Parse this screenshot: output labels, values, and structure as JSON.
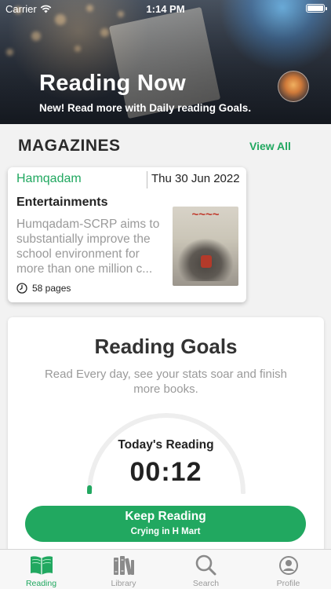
{
  "status_bar": {
    "carrier": "Carrier",
    "time": "1:14 PM"
  },
  "hero": {
    "title": "Reading Now",
    "subtitle": "New! Read more with Daily reading Goals."
  },
  "magazines": {
    "section_title": "MAGAZINES",
    "view_all": "View All",
    "card": {
      "publisher": "Hamqadam",
      "date": "Thu 30 Jun 2022",
      "category": "Entertainments",
      "description": "Humqadam-SCRP aims to substantially improve the school environment for more than one million c...",
      "pages": "58 pages"
    }
  },
  "reading_goals": {
    "title": "Reading Goals",
    "description": "Read Every day, see your stats soar and finish more books.",
    "today_label": "Today's Reading",
    "today_time": "00:12",
    "progress_fraction": 0.02,
    "button_label": "Keep Reading",
    "button_sublabel": "Crying in H Mart"
  },
  "tabs": [
    {
      "label": "Reading",
      "icon": "book-open-icon",
      "active": true
    },
    {
      "label": "Library",
      "icon": "library-icon",
      "active": false
    },
    {
      "label": "Search",
      "icon": "search-icon",
      "active": false
    },
    {
      "label": "Profile",
      "icon": "profile-icon",
      "active": false
    }
  ],
  "colors": {
    "accent": "#21a860",
    "text": "#222222",
    "muted": "#9a9a9a",
    "background": "#f2f2f2"
  }
}
